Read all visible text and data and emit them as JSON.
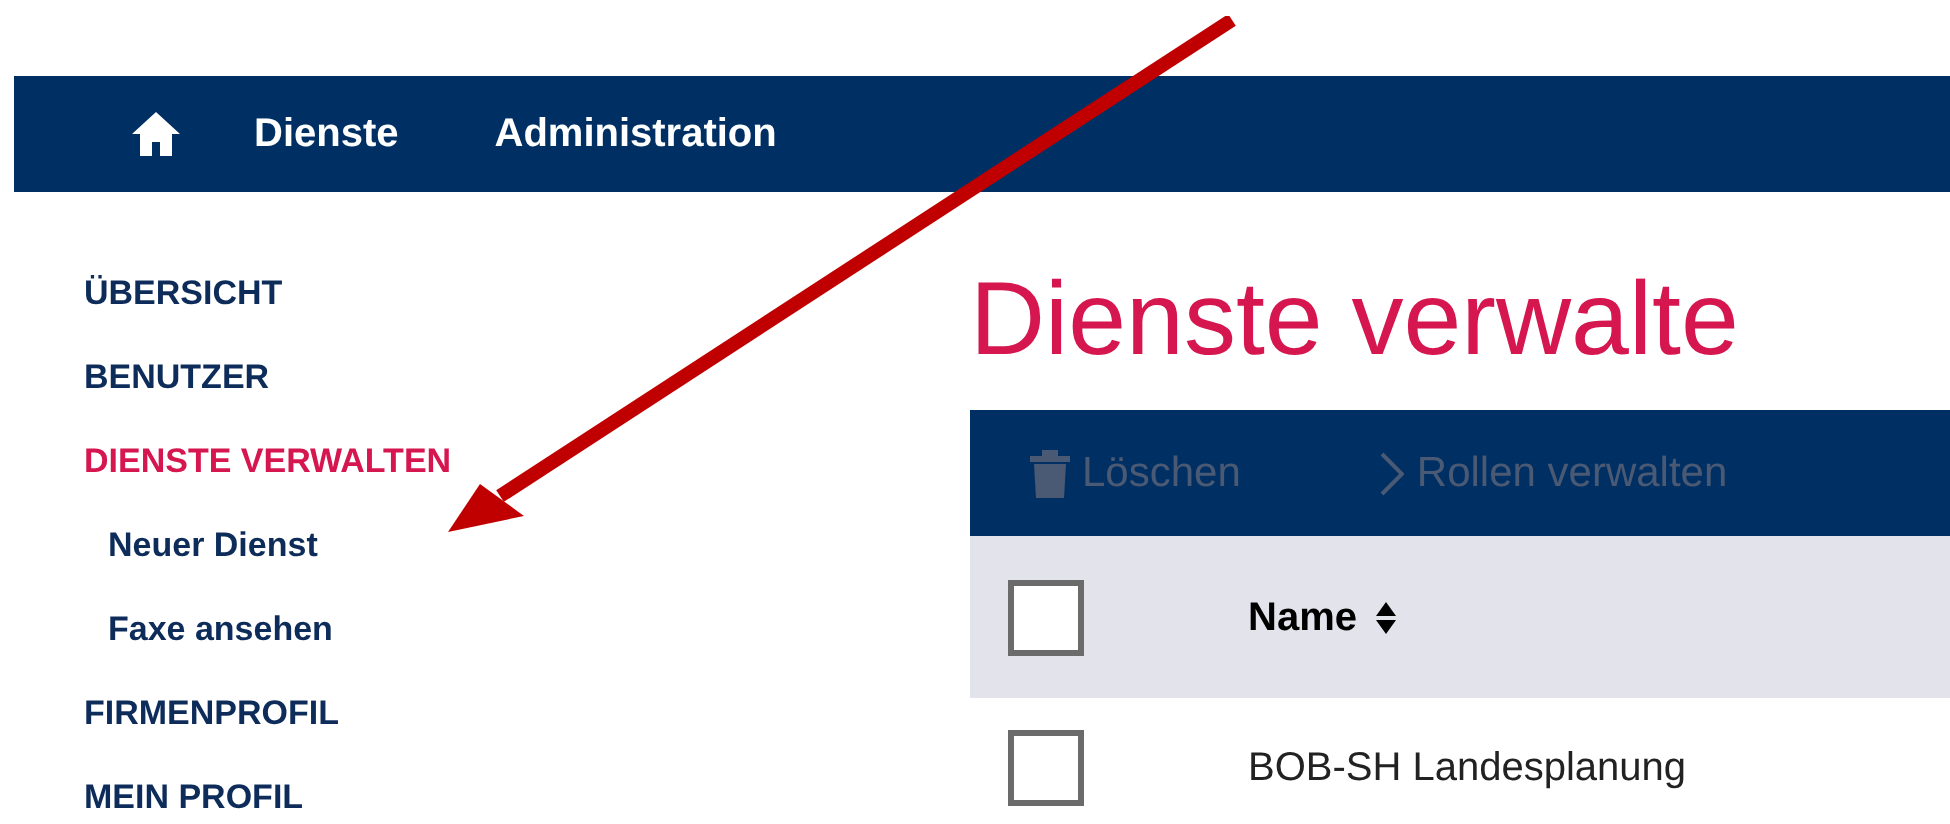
{
  "navbar": {
    "items": [
      {
        "kind": "home"
      },
      {
        "kind": "text",
        "label": "Dienste"
      },
      {
        "kind": "text",
        "label": "Administration"
      }
    ]
  },
  "sidebar": {
    "items": [
      {
        "label": "ÜBERSICHT",
        "selected": false
      },
      {
        "label": "BENUTZER",
        "selected": false
      },
      {
        "label": "DIENSTE VERWALTEN",
        "selected": true,
        "children": [
          {
            "label": "Neuer Dienst",
            "selected": false
          },
          {
            "label": "Faxe ansehen",
            "selected": false
          }
        ]
      },
      {
        "label": "FIRMENPROFIL",
        "selected": false
      },
      {
        "label": "MEIN PROFIL",
        "selected": false
      }
    ]
  },
  "page_title": "Dienste verwalte",
  "toolbar": [
    {
      "kind": "delete",
      "label": "Löschen",
      "disabled": true
    },
    {
      "kind": "chevron",
      "label": "Rollen verwalten",
      "disabled": true
    }
  ],
  "table": {
    "header": {
      "checked": false,
      "column": "Name"
    },
    "rows": [
      {
        "checked": false,
        "name": "BOB-SH Landesplanung"
      }
    ]
  }
}
